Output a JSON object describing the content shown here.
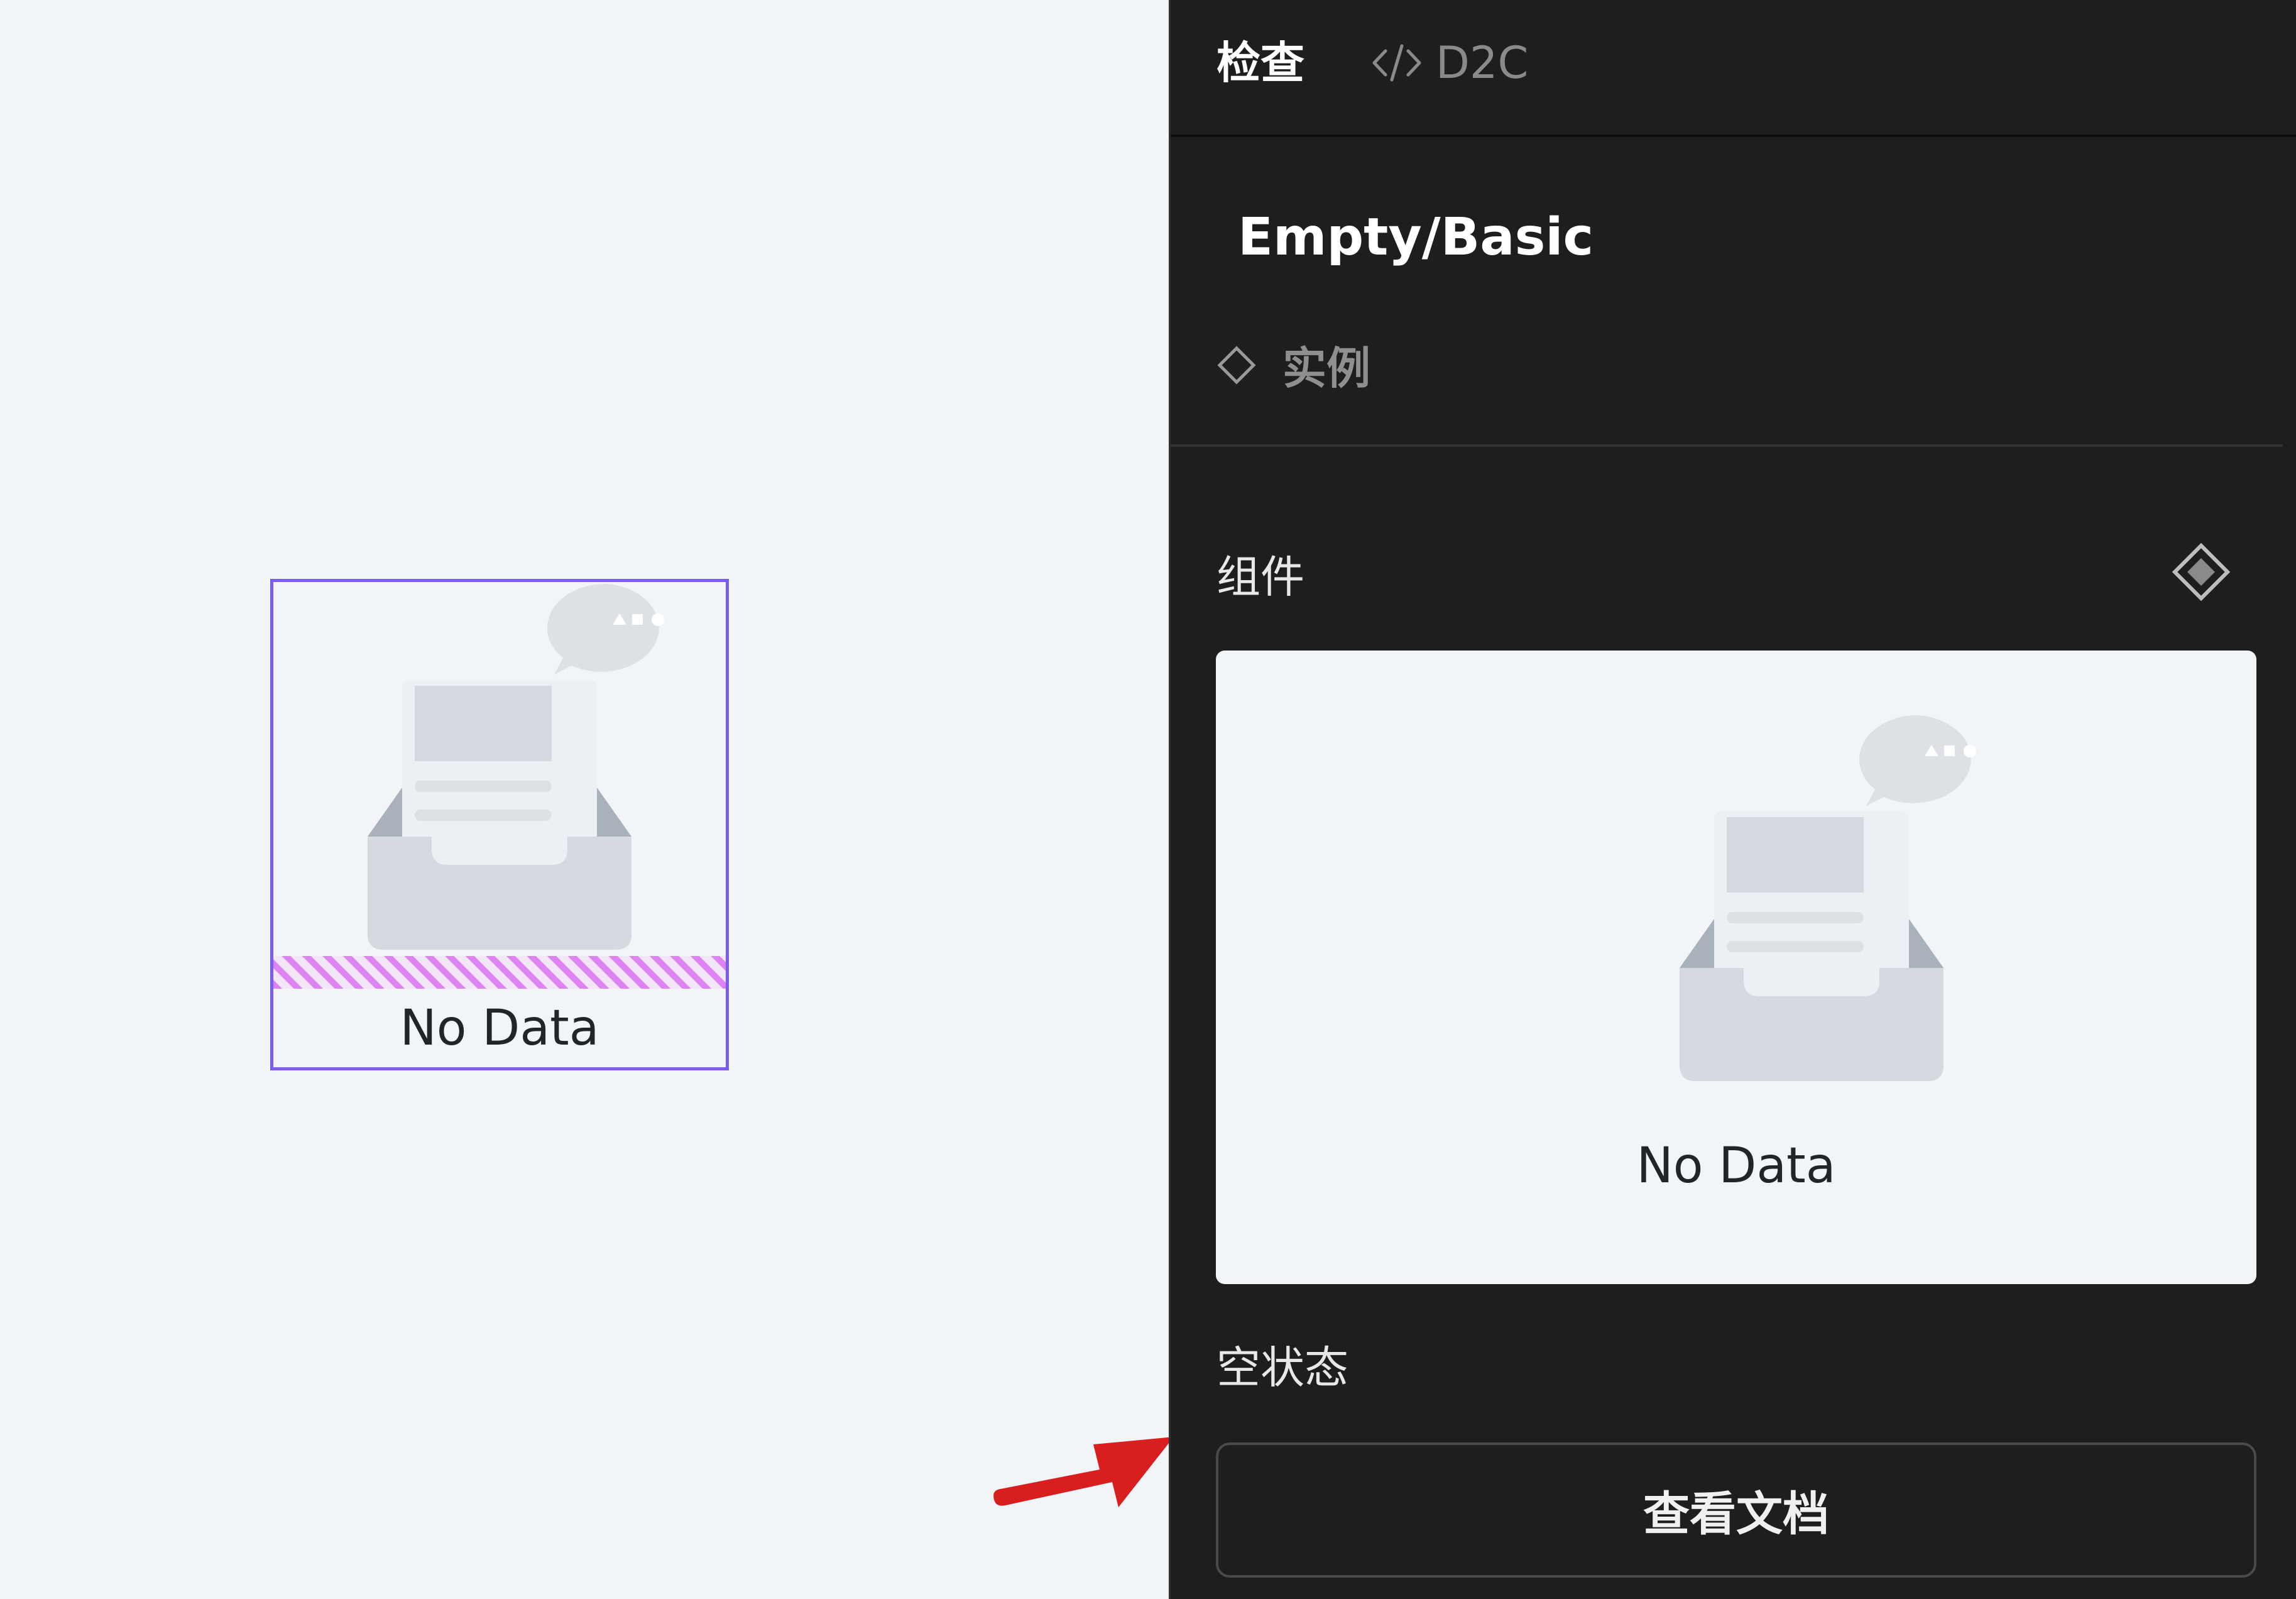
{
  "canvas": {
    "selected_component": {
      "label": "No Data",
      "icon": "empty-inbox-illustration",
      "frame_color": "#7b5cf0",
      "padding_hatch_color": "#de84f2"
    },
    "annotation": {
      "icon": "red-arrow",
      "color": "#d81e1e"
    }
  },
  "inspector": {
    "tabs": [
      {
        "label": "检查",
        "active": true
      },
      {
        "label": "D2C",
        "icon": "code-icon",
        "active": false
      }
    ],
    "component_name": "Empty/Basic",
    "instance": {
      "icon": "diamond-outline-icon",
      "label": "实例"
    },
    "component_section": {
      "label": "组件",
      "icon": "component-diamond-icon",
      "preview_label": "No Data",
      "preview_icon": "empty-inbox-illustration"
    },
    "description": "空状态",
    "doc_button": "查看文档"
  },
  "colors": {
    "canvas_bg": "#f2f5f7",
    "panel_bg": "#1e1e1e",
    "illustration_gray": "#d5dae0",
    "illustration_dark": "#a9b1ba"
  }
}
